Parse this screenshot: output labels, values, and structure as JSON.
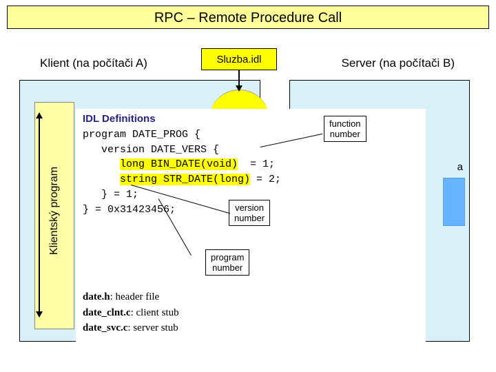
{
  "title": "RPC – Remote Procedure Call",
  "client_label": "Klient (na počítači A)",
  "server_label": "Server (na počítači B)",
  "idl_file": "Sluzba.idl",
  "sidebar_label": "Klientský program",
  "letter": "a",
  "idl": {
    "heading": "IDL Definitions",
    "l1": "program DATE_PROG {",
    "l2": "   version DATE_VERS {",
    "l3a": "      ",
    "l3b": "long BIN_DATE(void)",
    "l3c": "  = 1;",
    "l4a": "      ",
    "l4b": "string STR_DATE(long)",
    "l4c": " = 2;",
    "l5": "   } = 1;",
    "l6": "} = 0x31423456;"
  },
  "callouts": {
    "function": "function\nnumber",
    "version": "version\nnumber",
    "program": "program\nnumber"
  },
  "generated": {
    "h": "date.h",
    "h_desc": ": header file",
    "clnt": "date_clnt.c",
    "clnt_desc": ": client stub",
    "svc": "date_svc.c",
    "svc_desc": ": server stub"
  }
}
